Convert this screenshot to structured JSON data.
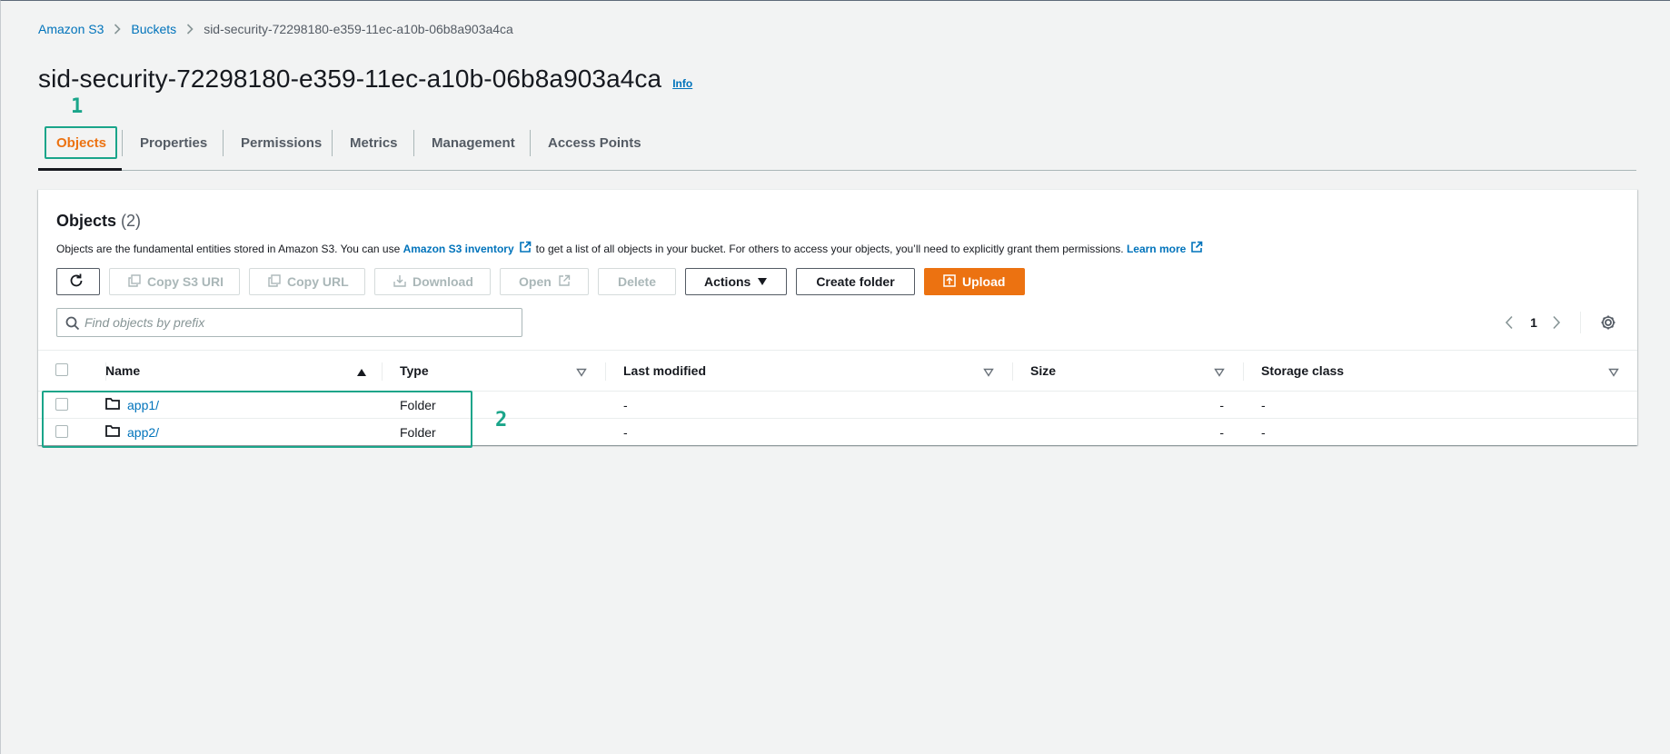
{
  "breadcrumb": {
    "items": [
      "Amazon S3",
      "Buckets"
    ],
    "current": "sid-security-72298180-e359-11ec-a10b-06b8a903a4ca"
  },
  "header": {
    "title": "sid-security-72298180-e359-11ec-a10b-06b8a903a4ca",
    "info": "Info"
  },
  "annotations": {
    "marker1": "1",
    "marker2": "2",
    "color": "#1aa58a"
  },
  "tabs": [
    {
      "label": "Objects",
      "active": true
    },
    {
      "label": "Properties"
    },
    {
      "label": "Permissions"
    },
    {
      "label": "Metrics"
    },
    {
      "label": "Management"
    },
    {
      "label": "Access Points"
    }
  ],
  "objects": {
    "title": "Objects",
    "count": "(2)",
    "description_part1": "Objects are the fundamental entities stored in Amazon S3. You can use",
    "inventory_link": "Amazon S3 inventory",
    "description_part2": "to get a list of all objects in your bucket. For others to access your objects, you’ll need to explicitly grant them permissions.",
    "learn_more": "Learn more"
  },
  "toolbar": {
    "copy_uri": "Copy S3 URI",
    "copy_url": "Copy URL",
    "download": "Download",
    "open": "Open",
    "delete": "Delete",
    "actions": "Actions",
    "create_folder": "Create folder",
    "upload": "Upload"
  },
  "search": {
    "placeholder": "Find objects by prefix",
    "value": ""
  },
  "pagination": {
    "page": "1"
  },
  "table": {
    "columns": [
      "Name",
      "Type",
      "Last modified",
      "Size",
      "Storage class"
    ],
    "rows": [
      {
        "name": "app1/",
        "type": "Folder",
        "modified": "-",
        "size": "-",
        "class": "-"
      },
      {
        "name": "app2/",
        "type": "Folder",
        "modified": "-",
        "size": "-",
        "class": "-"
      }
    ]
  },
  "colors": {
    "accent": "#ec7211",
    "link": "#0073bb",
    "text": "#16191f"
  }
}
